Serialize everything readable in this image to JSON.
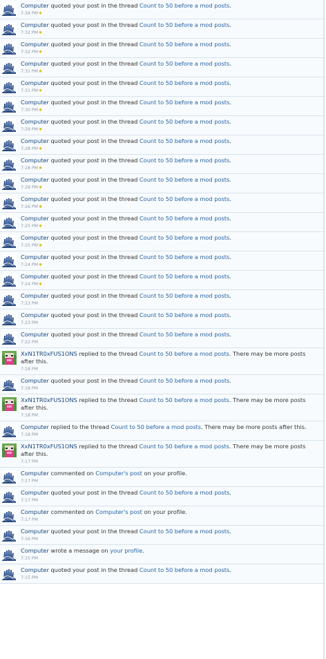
{
  "accent": "#2762a3",
  "avatars": {
    "computer": "hand-logo-icon",
    "xxn1tr0xfus1ons": "pixel-character-icon"
  },
  "items": [
    {
      "av": "computer",
      "user": "Computer",
      "pre": "quoted your post in the thread",
      "link": "Count to 50 before a mod posts",
      "post": ".",
      "time": "7:34 PM",
      "star": true
    },
    {
      "av": "computer",
      "user": "Computer",
      "pre": "quoted your post in the thread",
      "link": "Count to 50 before a mod posts",
      "post": ".",
      "time": "7:32 PM",
      "star": true
    },
    {
      "av": "computer",
      "user": "Computer",
      "pre": "quoted your post in the thread",
      "link": "Count to 50 before a mod posts",
      "post": ".",
      "time": "7:32 PM",
      "star": true
    },
    {
      "av": "computer",
      "user": "Computer",
      "pre": "quoted your post in the thread",
      "link": "Count to 50 before a mod posts",
      "post": ".",
      "time": "7:31 PM",
      "star": true
    },
    {
      "av": "computer",
      "user": "Computer",
      "pre": "quoted your post in the thread",
      "link": "Count to 50 before a mod posts",
      "post": ".",
      "time": "7:31 PM",
      "star": true
    },
    {
      "av": "computer",
      "user": "Computer",
      "pre": "quoted your post in the thread",
      "link": "Count to 50 before a mod posts",
      "post": ".",
      "time": "7:30 PM",
      "star": true
    },
    {
      "av": "computer",
      "user": "Computer",
      "pre": "quoted your post in the thread",
      "link": "Count to 50 before a mod posts",
      "post": ".",
      "time": "7:29 PM",
      "star": true
    },
    {
      "av": "computer",
      "user": "Computer",
      "pre": "quoted your post in the thread",
      "link": "Count to 50 before a mod posts",
      "post": ".",
      "time": "7:28 PM",
      "star": true
    },
    {
      "av": "computer",
      "user": "Computer",
      "pre": "quoted your post in the thread",
      "link": "Count to 50 before a mod posts",
      "post": ".",
      "time": "7:28 PM",
      "star": true
    },
    {
      "av": "computer",
      "user": "Computer",
      "pre": "quoted your post in the thread",
      "link": "Count to 50 before a mod posts",
      "post": ".",
      "time": "7:28 PM",
      "star": true
    },
    {
      "av": "computer",
      "user": "Computer",
      "pre": "quoted your post in the thread",
      "link": "Count to 50 before a mod posts",
      "post": ".",
      "time": "7:26 PM",
      "star": true
    },
    {
      "av": "computer",
      "user": "Computer",
      "pre": "quoted your post in the thread",
      "link": "Count to 50 before a mod posts",
      "post": ".",
      "time": "7:25 PM",
      "star": true
    },
    {
      "av": "computer",
      "user": "Computer",
      "pre": "quoted your post in the thread",
      "link": "Count to 50 before a mod posts",
      "post": ".",
      "time": "7:25 PM",
      "star": true
    },
    {
      "av": "computer",
      "user": "Computer",
      "pre": "quoted your post in the thread",
      "link": "Count to 50 before a mod posts",
      "post": ".",
      "time": "7:24 PM",
      "star": true
    },
    {
      "av": "computer",
      "user": "Computer",
      "pre": "quoted your post in the thread",
      "link": "Count to 50 before a mod posts",
      "post": ".",
      "time": "7:24 PM",
      "star": true
    },
    {
      "av": "computer",
      "user": "Computer",
      "pre": "quoted your post in the thread",
      "link": "Count to 50 before a mod posts",
      "post": ".",
      "time": "7:23 PM",
      "star": false
    },
    {
      "av": "computer",
      "user": "Computer",
      "pre": "quoted your post in the thread",
      "link": "Count to 50 before a mod posts",
      "post": ".",
      "time": "7:23 PM",
      "star": false
    },
    {
      "av": "computer",
      "user": "Computer",
      "pre": "quoted your post in the thread",
      "link": "Count to 50 before a mod posts",
      "post": ".",
      "time": "7:22 PM",
      "star": false
    },
    {
      "av": "xxn1tr0xfus1ons",
      "user": "XxN1TR0xFUS1ONS",
      "pre": "replied to the thread",
      "link": "Count to 50 before a mod posts",
      "post": ". There may be more posts after this.",
      "time": "7:18 PM",
      "star": false
    },
    {
      "av": "computer",
      "user": "Computer",
      "pre": "quoted your post in the thread",
      "link": "Count to 50 before a mod posts",
      "post": ".",
      "time": "7:18 PM",
      "star": false
    },
    {
      "av": "xxn1tr0xfus1ons",
      "user": "XxN1TR0xFUS1ONS",
      "pre": "replied to the thread",
      "link": "Count to 50 before a mod posts",
      "post": ". There may be more posts after this.",
      "time": "7:18 PM",
      "star": false
    },
    {
      "av": "computer",
      "user": "Computer",
      "pre": "replied to the thread",
      "link": "Count to 50 before a mod posts",
      "post": ". There may be more posts after this.",
      "time": "7:18 PM",
      "star": false
    },
    {
      "av": "xxn1tr0xfus1ons",
      "user": "XxN1TR0xFUS1ONS",
      "pre": "replied to the thread",
      "link": "Count to 50 before a mod posts",
      "post": ". There may be more posts after this.",
      "time": "7:17 PM",
      "star": false
    },
    {
      "av": "computer",
      "user": "Computer",
      "pre": "commented on",
      "link": "Computer's post",
      "post": "on your profile.",
      "time": "7:17 PM",
      "star": false
    },
    {
      "av": "computer",
      "user": "Computer",
      "pre": "quoted your post in the thread",
      "link": "Count to 50 before a mod posts",
      "post": ".",
      "time": "7:17 PM",
      "star": false
    },
    {
      "av": "computer",
      "user": "Computer",
      "pre": "commented on",
      "link": "Computer's post",
      "post": "on your profile.",
      "time": "7:17 PM",
      "star": false
    },
    {
      "av": "computer",
      "user": "Computer",
      "pre": "quoted your post in the thread",
      "link": "Count to 50 before a mod posts",
      "post": ".",
      "time": "7:16 PM",
      "star": false
    },
    {
      "av": "computer",
      "user": "Computer",
      "pre": "wrote a message on",
      "link": "your profile",
      "post": ".",
      "time": "7:15 PM",
      "star": false
    },
    {
      "av": "computer",
      "user": "Computer",
      "pre": "quoted your post in the thread",
      "link": "Count to 50 before a mod posts",
      "post": ".",
      "time": "7:15 PM",
      "star": false
    }
  ]
}
